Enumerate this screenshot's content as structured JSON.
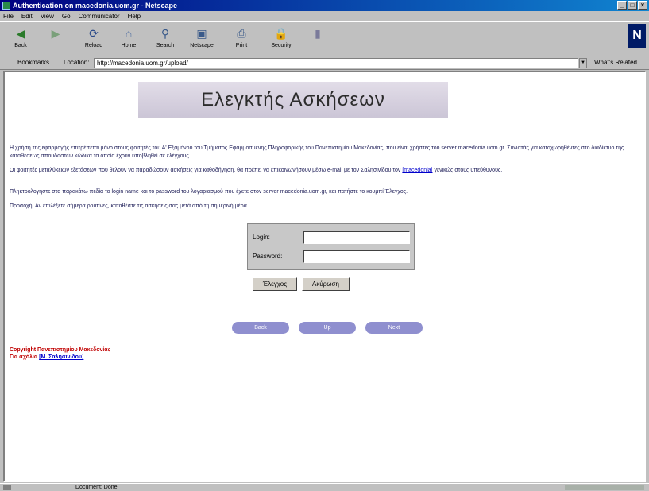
{
  "window": {
    "title": "Authentication on macedonia.uom.gr - Netscape",
    "controls": [
      "_",
      "□",
      "×"
    ]
  },
  "menubar": [
    "File",
    "Edit",
    "View",
    "Go",
    "Communicator",
    "Help"
  ],
  "toolbar": {
    "buttons": [
      {
        "label": "Back",
        "icon": "back-arrow-icon",
        "glyph": "◀"
      },
      {
        "label": "",
        "icon": "forward-arrow-icon",
        "glyph": "▶"
      },
      {
        "label": "Reload",
        "icon": "reload-icon",
        "glyph": "⟳"
      },
      {
        "label": "Home",
        "icon": "home-icon",
        "glyph": "⌂"
      },
      {
        "label": "Search",
        "icon": "search-icon",
        "glyph": "⚲"
      },
      {
        "label": "Netscape",
        "icon": "netscape-icon",
        "glyph": "▣"
      },
      {
        "label": "Print",
        "icon": "print-icon",
        "glyph": "⎙"
      },
      {
        "label": "Security",
        "icon": "security-lock-icon",
        "glyph": "🔒"
      },
      {
        "label": "",
        "icon": "stop-icon",
        "glyph": "▮"
      }
    ],
    "throbber": "N"
  },
  "location": {
    "bookmarks_label": "Bookmarks",
    "location_label": "Location:",
    "url": "http://macedonia.uom.gr/upload/",
    "related_label": "What's Related"
  },
  "page": {
    "banner_title": "Ελεγκτής Ασκήσεων",
    "p1": "Η χρήση της εφαρμογής επιτρέπεται μόνο στους φοιτητές του Α' Εξαμήνου του Τμήματος Εφαρμοσμένης Πληροφορικής του Πανεπιστημίου Μακεδονίας, που είναι χρήστες του server macedonia.uom.gr. Συνιστάς για καταχωρηθέντες στο διαδίκτυο της καταθέσεως σπουδαστών κώδικα τα οποία έχουν υποβληθεί σε ελέγχους.",
    "p2": "Οι φοιτητές μεταλύκειων εξετάσεων που θέλουν να παραδώσουν ασκήσεις για καθοδήγηση, θα πρέπει να επικοινωνήσουν μέσω e-mail με τον Σαλησινίδου τον",
    "p2_link": "[macedonia]",
    "p2_tail": "γενικώς στους υπεύθυνους.",
    "p3": "Πληκτρολογήστε στα παρακάτω πεδία το login name και το password του λογαριασμού που έχετε στον server macedonia.uom.gr, και πατήστε το κουμπί Έλεγχος.",
    "p4": "Προσοχή: Αν επιλέξετε σήμερα ρουτίνες, καταθέστε τις ασκήσεις σας μετά από τη σημερινή μέρα.",
    "login_label": "Login:",
    "password_label": "Password:",
    "submit_label": "Έλεγχος",
    "reset_label": "Ακύρωση",
    "nav_prev": "Back",
    "nav_up": "Up",
    "nav_next": "Next",
    "footer_line1": "Copyright Πανεπιστημίου Μακεδονίας",
    "footer_prefix": "Για σχόλια",
    "footer_link": "[Μ. Σαλησινίδου]"
  },
  "status": {
    "text": "Document: Done"
  }
}
